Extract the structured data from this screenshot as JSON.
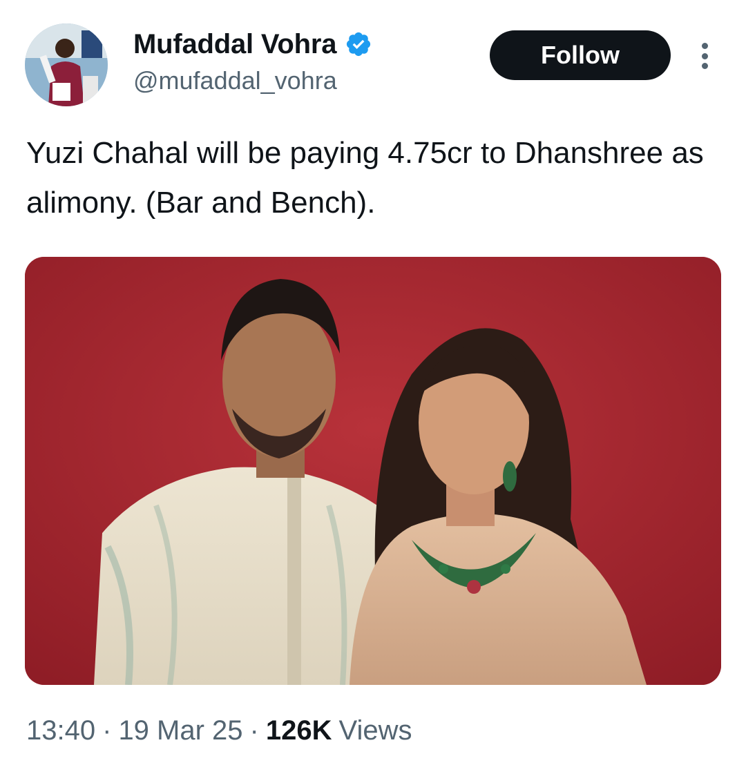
{
  "author": {
    "display_name": "Mufaddal Vohra",
    "handle": "@mufaddal_vohra",
    "verified": true,
    "verified_icon": "verified-badge-icon",
    "avatar_icon": "avatar"
  },
  "actions": {
    "follow_label": "Follow",
    "more_icon": "more-options-icon"
  },
  "tweet": {
    "text": "Yuzi Chahal will be paying 4.75cr to Dhanshree as alimony. (Bar and Bench)."
  },
  "meta": {
    "time": "13:40",
    "separator": "·",
    "date": "19 Mar 25",
    "views_count": "126K",
    "views_label": "Views"
  },
  "colors": {
    "text_primary": "#0f1419",
    "text_secondary": "#536471",
    "verified_blue": "#1d9bf0",
    "follow_bg": "#0f1419",
    "photo_background": "#a8262e"
  }
}
